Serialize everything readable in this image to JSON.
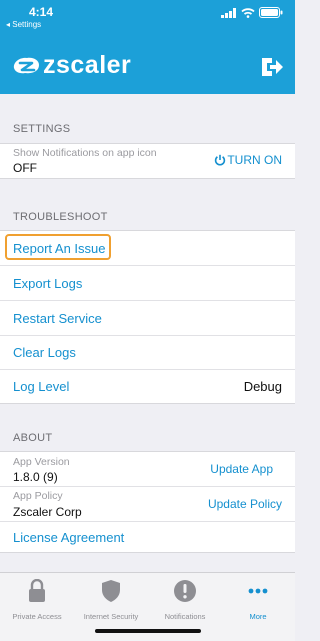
{
  "status": {
    "time": "4:14",
    "back_label": "◂ Settings"
  },
  "header": {
    "logo_text": "zscaler"
  },
  "settings": {
    "section_title": "SETTINGS",
    "notifications_label": "Show Notifications on app icon",
    "notifications_value": "OFF",
    "turn_on_label": "TURN ON"
  },
  "troubleshoot": {
    "section_title": "TROUBLESHOOT",
    "report": "Report An Issue",
    "export": "Export Logs",
    "restart": "Restart Service",
    "clear": "Clear Logs",
    "log_level_label": "Log Level",
    "log_level_value": "Debug"
  },
  "about": {
    "section_title": "ABOUT",
    "app_version_label": "App Version",
    "app_version_value": "1.8.0 (9)",
    "update_app": "Update App",
    "app_policy_label": "App Policy",
    "app_policy_value": "Zscaler Corp",
    "update_policy": "Update Policy",
    "license": "License Agreement"
  },
  "tabs": {
    "private_access": "Private Access",
    "internet_security": "Internet Security",
    "notifications": "Notifications",
    "more": "More"
  },
  "colors": {
    "brand": "#1ca0d8",
    "link": "#1590cf",
    "highlight": "#f0a030"
  }
}
